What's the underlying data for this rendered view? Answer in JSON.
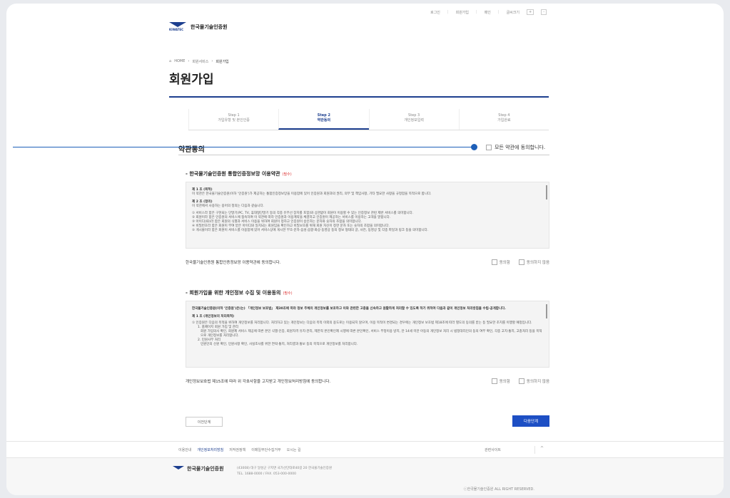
{
  "topbar": {
    "items": [
      "로그인",
      "회원가입",
      "메인",
      "글씨크기"
    ],
    "plus": "+",
    "minus": "-"
  },
  "logo": {
    "abbr": "KIWATEC",
    "name": "한국물기술인증원"
  },
  "breadcrumb": {
    "home": "HOME",
    "parent": "회원서비스",
    "current": "회원가입"
  },
  "page_title": "회원가입",
  "steps": [
    {
      "num": "Step 1",
      "label": "가입유형 및 본인인증"
    },
    {
      "num": "Step 2",
      "label": "약관동의"
    },
    {
      "num": "Step 3",
      "label": "개인정보입력"
    },
    {
      "num": "Step 4",
      "label": "가입완료"
    }
  ],
  "active_step": 1,
  "section_title": "약관동의",
  "agree_all_label": "모든 약관에 동의합니다.",
  "term1": {
    "heading": "- 한국물기술인증원 통합인증정보망 이용약관",
    "required": "(필수)",
    "art1_title": "제 1 조 (목적)",
    "art1_text": "이 약관은 한국물기술인증원(이하 '인증원')가 제공하는 통합인증정보망을 이용함에 있어 인증원과 회원과의 권리, 의무 및 책임사항, 기타 필요한 사항을 규정함을 목적으로 합니다.",
    "art2_title": "제 2 조 (정의)",
    "art2_intro": "이 약관에서 사용하는 용어의 정의는 다음과 같습니다.",
    "art2_items": [
      "① 서비스라 함은 구현되는 단말기(PC, TV, 휴대형단말기 등의 각종 유무선 장치를 포함)와 상관없이 회원이 이용할 수 있는 인증정보 관련 제반 서비스를 의미합니다.",
      "② 회원이라 함은 인증원의 서비스에 접속하여 이 약관에 따라 인증원과 이용계약을 체결하고 인증원이 제공하는 서비스를 이용하는 고객을 말합니다.",
      "③ 아이디(ID)라 함은 회원의 식별과 서비스 이용을 위하여 회원이 정하고 인증원이 승인하는 문자와 숫자의 조합을 의미합니다.",
      "④ 비밀번호라 함은 회원이 부여 받은 아이디와 일치되는 회원임을 확인하고 비밀보호를 위해 회원 자신이 정한 문자 또는 숫자의 조합을 의미합니다.",
      "⑤ 게시물이라 함은 회원이 서비스를 이용함에 있어 서비스상에 게시한 부호·문자·음성·음향·화상·동영상 등의 정보 형태의 글, 사진, 동영상 및 각종 파일과 링크 등을 의미합니다."
    ],
    "agree_text": "한국물기술인증원 통합인증정보망 이용약관에 동의합니다.",
    "opt_agree": "동의함",
    "opt_disagree": "동의하지 않음"
  },
  "term2": {
    "heading": "- 회원가입을 위한 개인정보 수집 및 이용동의",
    "required": "(필수)",
    "intro": "한국물기술인증원(이하 '인증원')은(는) 「개인정보 보호법」 제30조에 따라 정보 주체의 개인정보를 보호하고 이와 관련한 고충을 신속하고 원활하게 처리할 수 있도록 하기 위하여 다음과 같이 개인정보 처리방침을 수립·공개합니다.",
    "art1_title": "제 1 조 (개인정보의 처리목적)",
    "art1_items": [
      "① 인증원은 다음의 목적을 위하여 개인정보를 처리합니다. 처리하고 있는 개인정보는 다음의 목적 이외의 용도로는 이용되지 않으며, 이용 목적이 변경되는 경우에는 개인정보 보호법 제18조에 따라 별도의 동의를 받는 등 필요한 조치를 이행할 예정입니다.",
      "1. 홈페이지 회원 가입 및 관리",
      "회원 가입의사 확인, 회원제 서비스 제공에 따른 본인 식별·인증, 회원자격 유지·관리, 제한적 본인확인제 시행에 따른 본인확인, 서비스 부정이용 방지, 만 14세 미만 아동의 개인정보 처리 시 법정대리인의 동의 여부 확인, 각종 고지·통지, 고충처리 등을 목적으로 개인정보를 처리합니다.",
      "2. 민원사무 처리",
      "민원인의 신원 확인, 민원사항 확인, 사실조사를 위한 연락·통지, 처리결과 통보 등의 목적으로 개인정보를 처리합니다."
    ],
    "agree_text": "개인정보보호법 제15조에 따라 위 각호사항을 고지받고 개인정보처리방침에 동의합니다.",
    "opt_agree": "동의함",
    "opt_disagree": "동의하지 않음"
  },
  "buttons": {
    "prev": "이전단계",
    "next": "다음단계"
  },
  "footer_nav": {
    "links": [
      "이용안내",
      "개인정보처리방침",
      "저작권정책",
      "이메일무단수집거부",
      "오시는 길"
    ],
    "family": "관련사이트",
    "arrow": "^"
  },
  "footer": {
    "name": "한국물기술인증원",
    "address": "(43008) 대구 달성군 구지면 국가산단대로40길 20 한국물기술인증원",
    "phone": "TEL. 1688-0000 / FAX. 053-000-0000",
    "copyright": "ⓒ한국물기술인증원 ALL RIGHT RESERVED."
  },
  "colors": {
    "primary": "#1d3f8f",
    "button": "#1d4fc4",
    "required": "#dd3333",
    "leader": "#1d5fb8"
  }
}
